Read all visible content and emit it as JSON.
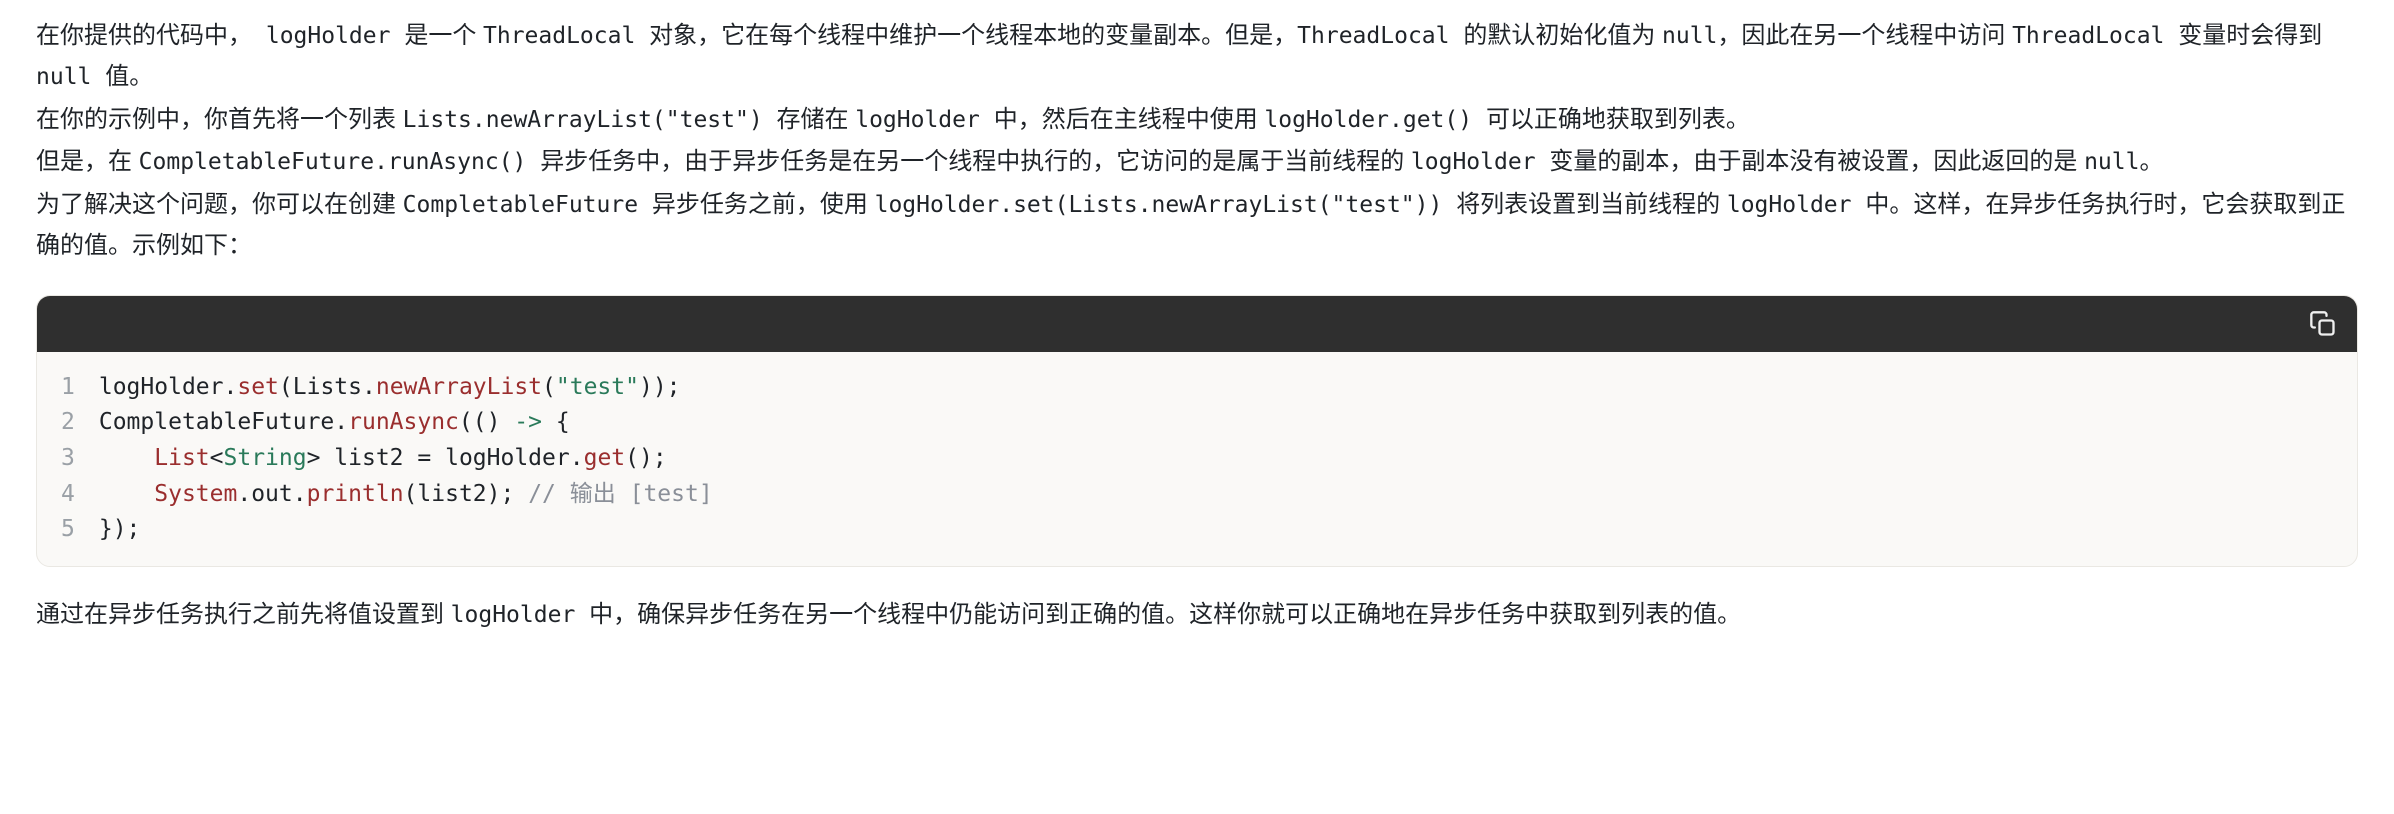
{
  "paragraphs": {
    "p1_a": "在你提供的代码中，",
    "p1_code1": " logHolder ",
    "p1_b": "是一个 ",
    "p1_code2": "ThreadLocal ",
    "p1_c": "对象，它在每个线程中维护一个线程本地的变量副本。但是，",
    "p1_code3": "ThreadLocal ",
    "p1_d": "的默认初始化值为 ",
    "p1_code4": "null",
    "p1_e": "，因此在另一个线程中访问 ",
    "p1_code5": "ThreadLocal ",
    "p1_f": "变量时会得到 ",
    "p1_code6": "null ",
    "p1_g": "值。",
    "p2_a": "在你的示例中，你首先将一个列表 ",
    "p2_code1": "Lists.newArrayList(\"test\") ",
    "p2_b": "存储在 ",
    "p2_code2": "logHolder ",
    "p2_c": "中，然后在主线程中使用 ",
    "p2_code3": "logHolder.get() ",
    "p2_d": "可以正确地获取到列表。",
    "p3_a": "但是，在 ",
    "p3_code1": "CompletableFuture.runAsync() ",
    "p3_b": "异步任务中，由于异步任务是在另一个线程中执行的，它访问的是属于当前线程的 ",
    "p3_code2": "logHolder ",
    "p3_c": "变量的副本，由于副本没有被设置，因此返回的是 ",
    "p3_code3": "null",
    "p3_d": "。",
    "p4_a": "为了解决这个问题，你可以在创建 ",
    "p4_code1": "CompletableFuture ",
    "p4_b": "异步任务之前，使用 ",
    "p4_code2": "logHolder.set(Lists.newArrayList(\"test\")) ",
    "p4_c": "将列表设置到当前线程的 ",
    "p4_code3": "logHolder ",
    "p4_d": "中。这样，在异步任务执行时，它会获取到正确的值。示例如下：",
    "p5_a": "通过在异步任务执行之前先将值设置到 ",
    "p5_code1": "logHolder ",
    "p5_b": "中，确保异步任务在另一个线程中仍能访问到正确的值。这样你就可以正确地在异步任务中获取到列表的值。"
  },
  "code": {
    "line_numbers": [
      "1",
      "2",
      "3",
      "4",
      "5"
    ],
    "l1": {
      "a": "logHolder",
      "b": ".",
      "c": "set",
      "d": "(",
      "e": "Lists",
      "f": ".",
      "g": "newArrayList",
      "h": "(",
      "i": "\"test\"",
      "j": "));"
    },
    "l2": {
      "a": "CompletableFuture",
      "b": ".",
      "c": "runAsync",
      "d": "(() ",
      "e": "->",
      "f": " {"
    },
    "l3": {
      "indent": "    ",
      "a": "List",
      "b": "<",
      "c": "String",
      "d": "> ",
      "e": "list2 ",
      "f": "=",
      "g": " logHolder",
      "h": ".",
      "i": "get",
      "j": "();"
    },
    "l4": {
      "indent": "    ",
      "a": "System",
      "b": ".",
      "c": "out",
      "d": ".",
      "e": "println",
      "f": "(",
      "g": "list2",
      "h": "); ",
      "i": "// 输出 [test]"
    },
    "l5": {
      "a": "});"
    }
  }
}
